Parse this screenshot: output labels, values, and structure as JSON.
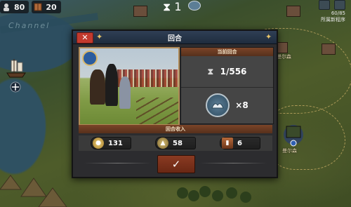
{
  "hud": {
    "resource1_value": "80",
    "resource2_value": "20",
    "center_value": "1",
    "right_value": "60/85",
    "right_label": "所属新程序"
  },
  "map": {
    "ghost_text": "Channel",
    "city_labels": [
      "曼尔森",
      "曼尔森"
    ]
  },
  "dialog": {
    "title": "回合",
    "close_label": "✕",
    "current_turn_header": "当前回合",
    "turn_value": "1/556",
    "multiplier_value": "×8",
    "income_header": "回合收入",
    "resources": [
      {
        "icon": "gold-coin-icon",
        "value": "131"
      },
      {
        "icon": "industry-icon",
        "value": "58"
      },
      {
        "icon": "book-icon",
        "value": "6"
      }
    ],
    "confirm_label": "✓"
  },
  "colors": {
    "header_blue": "#2f3f55",
    "section_brown": "#7a4428",
    "close_red": "#c23a2e",
    "confirm_brown": "#8a3a22"
  }
}
